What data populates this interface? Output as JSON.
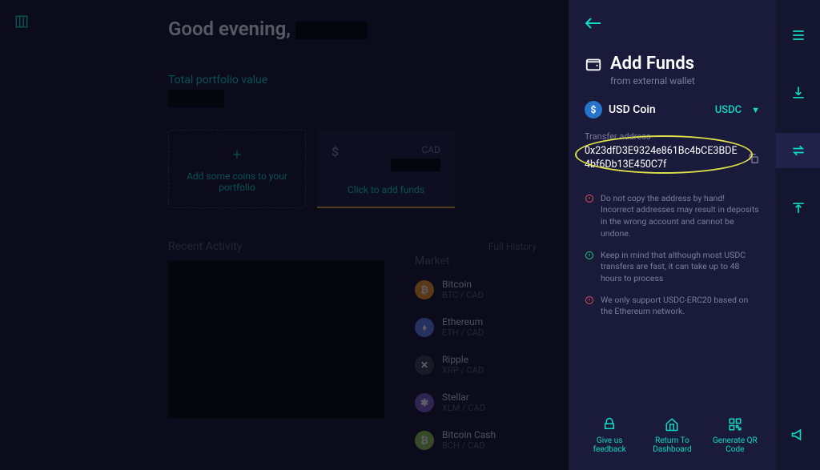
{
  "greeting": "Good evening,",
  "portfolio": {
    "label": "Total portfolio value"
  },
  "addCard": {
    "label": "Add some coins to your portfolio"
  },
  "fundsCard": {
    "currency": "CAD",
    "link": "Click to add funds"
  },
  "activity": {
    "title": "Recent Activity",
    "history": "Full History"
  },
  "market": {
    "title": "Market",
    "coins": [
      {
        "name": "Bitcoin",
        "pair": "BTC / CAD",
        "bg": "#f7931a",
        "sym": "₿"
      },
      {
        "name": "Ethereum",
        "pair": "ETH / CAD",
        "bg": "#627eea",
        "sym": "♦"
      },
      {
        "name": "Ripple",
        "pair": "XRP / CAD",
        "bg": "#3a3a4a",
        "sym": "✕"
      },
      {
        "name": "Stellar",
        "pair": "XLM / CAD",
        "bg": "#7d5cc6",
        "sym": "✱"
      },
      {
        "name": "Bitcoin Cash",
        "pair": "BCH / CAD",
        "bg": "#8dc351",
        "sym": "₿"
      }
    ]
  },
  "panel": {
    "title": "Add Funds",
    "subtitle": "from external wallet",
    "coin": {
      "name": "USD Coin",
      "symbol": "USDC"
    },
    "addressLabel": "Transfer address",
    "address": "0x23dfD3E9324e861Bc4bCE3BDE4bf6Db13E450C7f",
    "notes": [
      {
        "type": "red",
        "text": "Do not copy the address by hand! Incorrect addresses may result in deposits in the wrong account and cannot be undone."
      },
      {
        "type": "grn",
        "text": "Keep in mind that although most USDC transfers are fast, it can take up to 48 hours to process"
      },
      {
        "type": "red",
        "text": "We only support USDC-ERC20 based on the Ethereum network."
      }
    ],
    "footer": {
      "feedback": "Give us feedback",
      "dashboard": "Return To Dashboard",
      "qr": "Generate QR Code"
    }
  }
}
